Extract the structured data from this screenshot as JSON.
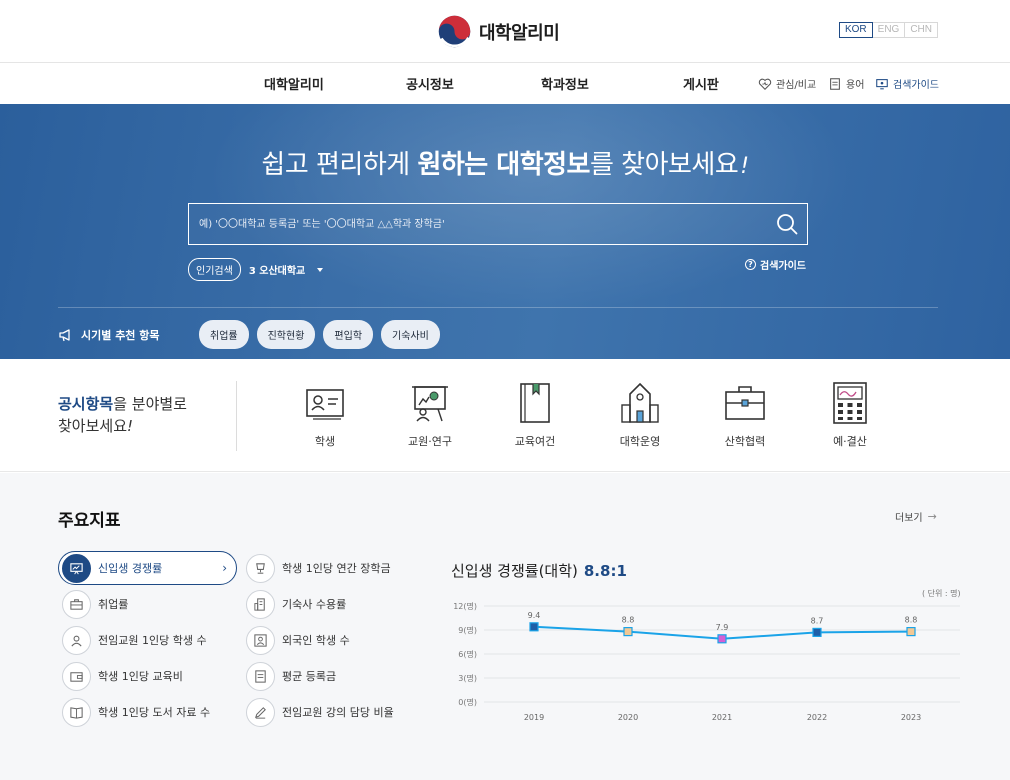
{
  "header": {
    "logo_text": "대학알리미",
    "languages": [
      "KOR",
      "ENG",
      "CHN"
    ]
  },
  "nav": {
    "items": [
      "대학알리미",
      "공시정보",
      "학과정보",
      "게시판"
    ],
    "utils": [
      {
        "label": "관심/비교",
        "icon": "heart-icon"
      },
      {
        "label": "용어",
        "icon": "glossary-icon"
      },
      {
        "label": "검색가이드",
        "icon": "monitor-icon"
      }
    ]
  },
  "hero": {
    "title_prefix": "쉽고 편리하게 ",
    "title_bold1": "원하는 대학정보",
    "title_suffix": "를 찾아보세요",
    "title_mark": "!",
    "search_placeholder": "예) '〇〇대학교 등록금' 또는 '〇〇대학교 △△학과 장학금'",
    "popular_label": "인기검색",
    "popular_item": "3 오산대학교",
    "search_guide": "검색가이드",
    "season_label": "시기별 추천 항목",
    "season_chips": [
      "취업률",
      "진학현황",
      "편입학",
      "기숙사비"
    ]
  },
  "category": {
    "title_bold": "공시항목",
    "title_rest": "을 분야별로",
    "title_line2": "찾아보세요",
    "title_mark": "!",
    "items": [
      {
        "label": "학생",
        "icon": "id-card-icon"
      },
      {
        "label": "교원·연구",
        "icon": "presentation-icon"
      },
      {
        "label": "교육여건",
        "icon": "book-icon"
      },
      {
        "label": "대학운영",
        "icon": "building-icon"
      },
      {
        "label": "산학협력",
        "icon": "briefcase-icon"
      },
      {
        "label": "예·결산",
        "icon": "calculator-icon"
      }
    ]
  },
  "indicators": {
    "title": "주요지표",
    "more": "더보기",
    "left_items": [
      {
        "label": "신입생 경쟁률",
        "icon": "presentation-icon",
        "active": true
      },
      {
        "label": "취업률",
        "icon": "briefcase-icon"
      },
      {
        "label": "전임교원 1인당 학생 수",
        "icon": "users-icon"
      },
      {
        "label": "학생 1인당 교육비",
        "icon": "wallet-icon"
      },
      {
        "label": "학생 1인당 도서 자료 수",
        "icon": "book-open-icon"
      }
    ],
    "right_items": [
      {
        "label": "학생 1인당 연간 장학금",
        "icon": "trophy-icon"
      },
      {
        "label": "기숙사 수용률",
        "icon": "building-icon"
      },
      {
        "label": "외국인 학생 수",
        "icon": "person-card-icon"
      },
      {
        "label": "평균 등록금",
        "icon": "document-icon"
      },
      {
        "label": "전임교원 강의 담당 비율",
        "icon": "pencil-icon"
      }
    ],
    "chart_heading": "신입생 경쟁률(대학)",
    "chart_heading_value": "8.8:1",
    "chart_unit": "( 단위 : 명)"
  },
  "chart_data": {
    "type": "line",
    "title": "신입생 경쟁률(대학)",
    "categories": [
      "2019",
      "2020",
      "2021",
      "2022",
      "2023"
    ],
    "values": [
      9.4,
      8.8,
      7.9,
      8.7,
      8.8
    ],
    "value_labels": [
      "9.4",
      "8.8",
      "7.9",
      "8.7",
      "8.8"
    ],
    "y_ticks": [
      "0(명)",
      "3(명)",
      "6(명)",
      "9(명)",
      "12(명)"
    ],
    "ylim": [
      0,
      12
    ],
    "line_color": "#1aa3e8",
    "marker_colors": [
      "#1e5fa8",
      "#f2c894",
      "#d45fd4",
      "#1e5fa8",
      "#f2c894"
    ]
  }
}
